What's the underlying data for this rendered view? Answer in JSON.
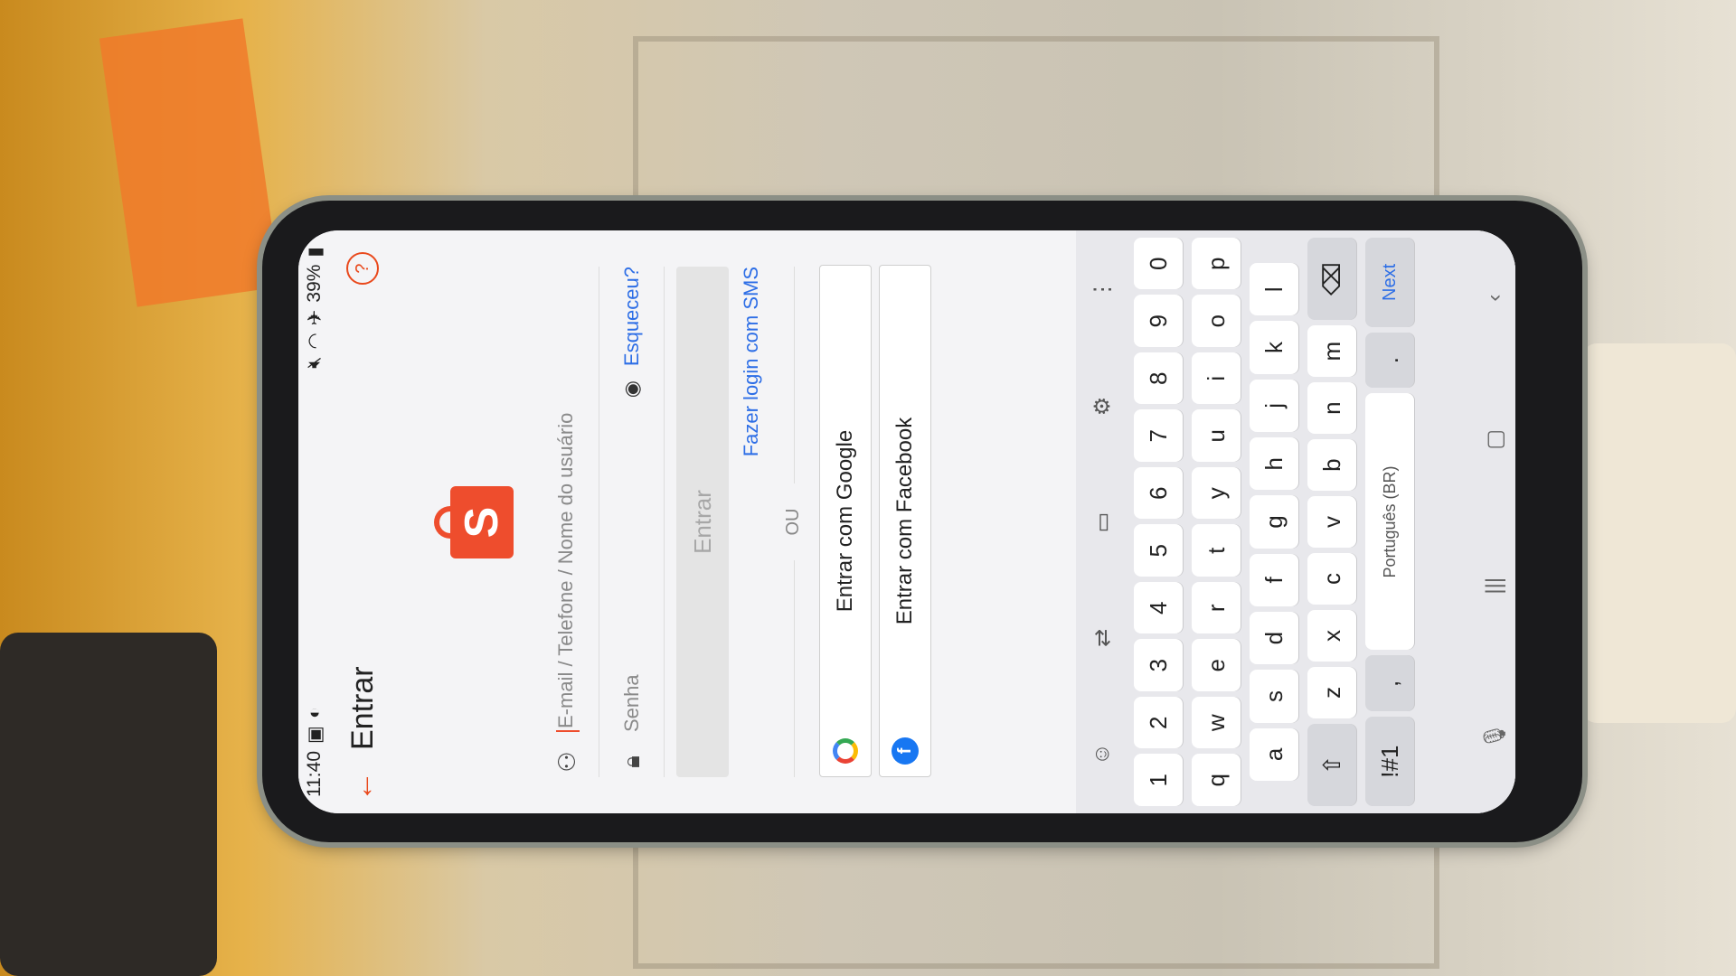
{
  "status_bar": {
    "time": "11:40",
    "battery": "39%"
  },
  "header": {
    "back_icon": "arrow-left-icon",
    "title": "Entrar",
    "help_icon": "question-circle-icon"
  },
  "logo": {
    "letter": "S",
    "brand_color": "#ee4d2d"
  },
  "login_form": {
    "username_placeholder": "E-mail / Telefone / Nome do usuário",
    "password_placeholder": "Senha",
    "forgot_link": "Esqueceu?",
    "submit_label": "Entrar",
    "sms_link": "Fazer login com SMS",
    "divider": "OU"
  },
  "social": {
    "google_label": "Entrar com Google",
    "facebook_label": "Entrar com Facebook"
  },
  "keyboard": {
    "numbers": [
      "1",
      "2",
      "3",
      "4",
      "5",
      "6",
      "7",
      "8",
      "9",
      "0"
    ],
    "row1": [
      "q",
      "w",
      "e",
      "r",
      "t",
      "y",
      "u",
      "i",
      "o",
      "p"
    ],
    "row2": [
      "a",
      "s",
      "d",
      "f",
      "g",
      "h",
      "j",
      "k",
      "l"
    ],
    "row3": [
      "z",
      "x",
      "c",
      "v",
      "b",
      "n",
      "m"
    ],
    "symbols_key": "!#1",
    "comma_key": ",",
    "space_label": "Português (BR)",
    "period_key": ".",
    "next_key": "Next"
  }
}
